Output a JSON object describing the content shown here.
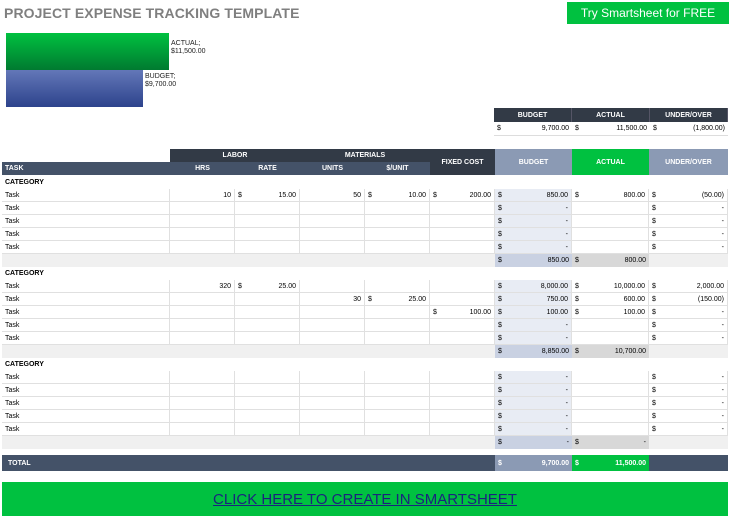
{
  "header": {
    "title": "PROJECT EXPENSE TRACKING TEMPLATE",
    "try_button": "Try Smartsheet for FREE"
  },
  "chart_data": {
    "type": "bar",
    "categories": [
      "ACTUAL",
      "BUDGET"
    ],
    "values": [
      11500,
      9700
    ],
    "labels": [
      "ACTUAL; $11,500.00",
      "BUDGET; $9,700.00"
    ],
    "colors": [
      "#00c140",
      "#2d438c"
    ]
  },
  "summary": {
    "headers": [
      "BUDGET",
      "ACTUAL",
      "UNDER/OVER"
    ],
    "values": [
      "9,700.00",
      "11,500.00",
      "(1,800.00)"
    ],
    "currency": "$"
  },
  "table": {
    "group_labor": "LABOR",
    "group_materials": "MATERIALS",
    "col_task": "TASK",
    "col_hrs": "HRS",
    "col_rate": "RATE",
    "col_units": "UNITS",
    "col_unit_price": "$/UNIT",
    "col_fixed": "FIXED COST",
    "col_budget": "BUDGET",
    "col_actual": "ACTUAL",
    "col_under": "UNDER/OVER",
    "categories": [
      {
        "label": "CATEGORY",
        "rows": [
          {
            "task": "Task",
            "hrs": "10",
            "rate": "15.00",
            "units": "50",
            "unit_price": "10.00",
            "fixed": "200.00",
            "budget": "850.00",
            "actual": "800.00",
            "under": "(50.00)"
          },
          {
            "task": "Task",
            "hrs": "",
            "rate": "",
            "units": "",
            "unit_price": "",
            "fixed": "",
            "budget": "-",
            "actual": "",
            "under": "-"
          },
          {
            "task": "Task",
            "hrs": "",
            "rate": "",
            "units": "",
            "unit_price": "",
            "fixed": "",
            "budget": "-",
            "actual": "",
            "under": "-"
          },
          {
            "task": "Task",
            "hrs": "",
            "rate": "",
            "units": "",
            "unit_price": "",
            "fixed": "",
            "budget": "-",
            "actual": "",
            "under": "-"
          },
          {
            "task": "Task",
            "hrs": "",
            "rate": "",
            "units": "",
            "unit_price": "",
            "fixed": "",
            "budget": "-",
            "actual": "",
            "under": "-"
          }
        ],
        "subtotal_budget": "850.00",
        "subtotal_actual": "800.00"
      },
      {
        "label": "CATEGORY",
        "rows": [
          {
            "task": "Task",
            "hrs": "320",
            "rate": "25.00",
            "units": "",
            "unit_price": "",
            "fixed": "",
            "budget": "8,000.00",
            "actual": "10,000.00",
            "under": "2,000.00"
          },
          {
            "task": "Task",
            "hrs": "",
            "rate": "",
            "units": "30",
            "unit_price": "25.00",
            "fixed": "",
            "budget": "750.00",
            "actual": "600.00",
            "under": "(150.00)"
          },
          {
            "task": "Task",
            "hrs": "",
            "rate": "",
            "units": "",
            "unit_price": "",
            "fixed": "100.00",
            "budget": "100.00",
            "actual": "100.00",
            "under": "-"
          },
          {
            "task": "Task",
            "hrs": "",
            "rate": "",
            "units": "",
            "unit_price": "",
            "fixed": "",
            "budget": "-",
            "actual": "",
            "under": "-"
          },
          {
            "task": "Task",
            "hrs": "",
            "rate": "",
            "units": "",
            "unit_price": "",
            "fixed": "",
            "budget": "-",
            "actual": "",
            "under": "-"
          }
        ],
        "subtotal_budget": "8,850.00",
        "subtotal_actual": "10,700.00"
      },
      {
        "label": "CATEGORY",
        "rows": [
          {
            "task": "Task",
            "hrs": "",
            "rate": "",
            "units": "",
            "unit_price": "",
            "fixed": "",
            "budget": "-",
            "actual": "",
            "under": "-"
          },
          {
            "task": "Task",
            "hrs": "",
            "rate": "",
            "units": "",
            "unit_price": "",
            "fixed": "",
            "budget": "-",
            "actual": "",
            "under": "-"
          },
          {
            "task": "Task",
            "hrs": "",
            "rate": "",
            "units": "",
            "unit_price": "",
            "fixed": "",
            "budget": "-",
            "actual": "",
            "under": "-"
          },
          {
            "task": "Task",
            "hrs": "",
            "rate": "",
            "units": "",
            "unit_price": "",
            "fixed": "",
            "budget": "-",
            "actual": "",
            "under": "-"
          },
          {
            "task": "Task",
            "hrs": "",
            "rate": "",
            "units": "",
            "unit_price": "",
            "fixed": "",
            "budget": "-",
            "actual": "",
            "under": "-"
          }
        ],
        "subtotal_budget": "-",
        "subtotal_actual": "-"
      }
    ],
    "total_label": "TOTAL",
    "total_budget": "9,700.00",
    "total_actual": "11,500.00"
  },
  "cta": {
    "label": "CLICK HERE TO CREATE IN SMARTSHEET"
  }
}
